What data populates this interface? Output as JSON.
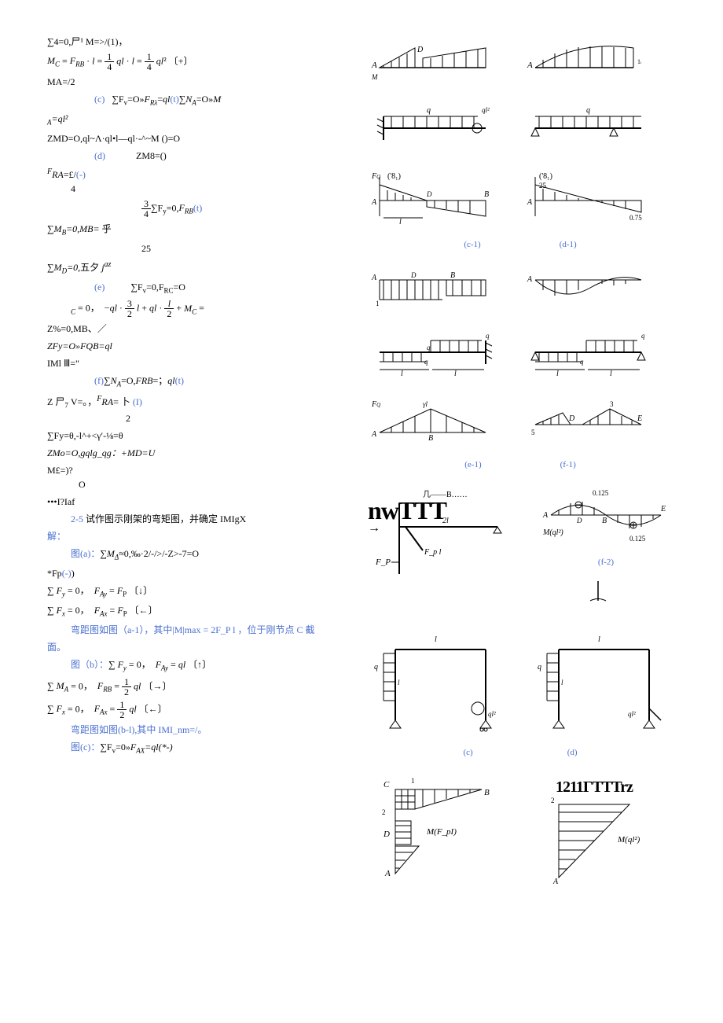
{
  "eqs": {
    "top1": "∑4=0,尸¹ M=>/(1)，",
    "mc": "M_C = F_RB · l = ¼ ql · l = ¼ ql² 〔+〕",
    "ma": "MA=/2",
    "c_line": "(c)    ∑Fv=O»F_Rλ=ql(t)∑Nₐ=O»M",
    "c_suffix": "A=ql²",
    "zmd": "ZMD=O,ql~Λ·ql•l—ql·-^~M ()=O",
    "d_line": "(d)             ZM8=()",
    "fra": "ᶠRA=£/(-)",
    "fra_num": "4",
    "d_fy": "¾∑Fy=0,F_RB(t)",
    "mb": "∑Mв=0,MB= 乎",
    "md_25": "25",
    "md": "∑Mᴅ=0,五夕 jᵃᵗ",
    "e_line": "(e)            ∑Fv=0,FRC=O",
    "e_eq": "C = 0，  −ql · 3/2 l + ql · l/2 + M_C =",
    "zpc": "Z%=0,MB、／",
    "zfy": "ZFy=O»FQB=ql",
    "iml": "IMl Ⅲ=\"",
    "f_line": "(f)∑Nₐ=O,FRB=；ql(t)",
    "zp7": "Z 尸₇ V=。，ᶠRA= 卜 (I)",
    "zp7_num": "2",
    "fy_theta": "∑Fy=θ,-l^+<γ′-⅛=θ",
    "zmo": "ZMo=O,gqlg_qg：+MD=U",
    "me": "M£=)?",
    "me_o": "O",
    "iaf": "•••I?Iaf",
    "prob25": "2-5 试作图示刚架的弯矩图，并确定 IMIgX",
    "jie": "解：",
    "fig_a": "图(a)：∑M∆≈0,‰·2/-/>/-Z>-7=O",
    "fp": "*Fp(-))",
    "sum_fy": "∑ Fy = 0，  F_Ay = F_P 〔↓〕",
    "sum_fx": "∑ Fx = 0，  F_Ax = F_P 〔←〕",
    "moment_a1": "弯距图如图（a-1），其中|M|max = 2F_P l ，位于刚节点 C 截",
    "mian": "面。",
    "fig_b": "图（b）：∑ Fy = 0，  F_Ay = ql 〔↑〕",
    "ma0": "∑ M_A = 0，  F_RB = ½ ql 〔→〕",
    "fx0": "∑ Fx = 0，  F_Ax = ½ ql 〔←〕",
    "moment_b1": "弯距图如图(b-l),其中 IMI_nm=/。",
    "fig_c": "图(c)：∑Fv=0»F_AX=ql(*-)"
  },
  "labels": {
    "c1": "(c-1)",
    "d1": "(d-1)",
    "e1": "(e-1)",
    "f1": "(f-1)",
    "f2": "(f-2)",
    "c": "(c)",
    "d": "(d)",
    "overlay1": "nwTTT",
    "overlay2": "1211ГТТTrz",
    "mfpi": "M(F_pI)",
    "mql2": "M(ql²)"
  },
  "diag": {
    "ql2_top": "ql²",
    "A": "A",
    "B": "B",
    "C": "C",
    "D": "D",
    "E": "E",
    "q": "q",
    "l": "l",
    "FQ": "F_Q",
    "val075": "0.75",
    "val25": "25",
    "val0125a": "0.125",
    "val0125b": "0.125",
    "twol": "2l",
    "Fpl": "F_p l",
    "Fp": "F_P",
    "num1": "1",
    "num2": "2",
    "num3": "3",
    "num5": "5",
    "gammal": "γl"
  }
}
